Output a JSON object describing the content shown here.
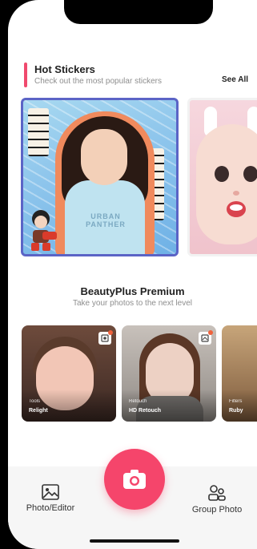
{
  "hot_stickers": {
    "title": "Hot Stickers",
    "subtitle": "Check out the most popular stickers",
    "see_all": "See All",
    "hoodie_text": "URBAN PANTHER"
  },
  "premium": {
    "title": "BeautyPlus Premium",
    "subtitle": "Take your photos to the next level",
    "features": [
      {
        "category": "Tools",
        "name": "Relight"
      },
      {
        "category": "Retouch",
        "name": "HD Retouch"
      },
      {
        "category": "Filters",
        "name": "Ruby"
      }
    ]
  },
  "bottom_nav": {
    "left_label": "Photo/Editor",
    "right_label": "Group Photo"
  },
  "colors": {
    "accent": "#f04a6e",
    "camera": "#f5456b",
    "sticker_border": "#5b64c6"
  },
  "icons": {
    "left": "image-icon",
    "center": "camera-icon",
    "right": "group-icon",
    "badge": "sticker-badge-icon"
  }
}
